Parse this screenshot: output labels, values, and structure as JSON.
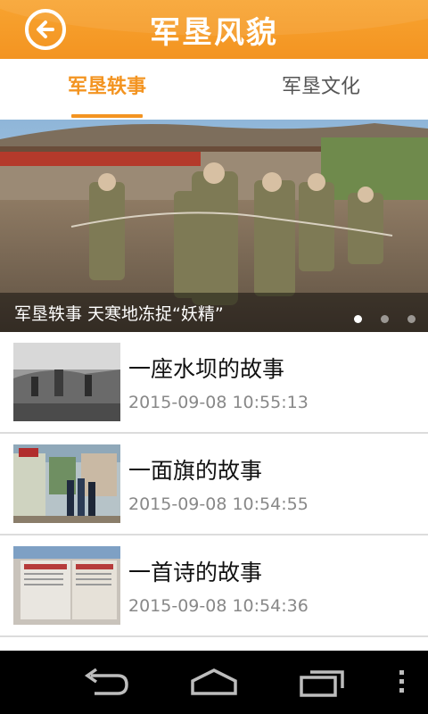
{
  "header": {
    "title": "军垦风貌",
    "back_icon": "back-arrow-icon",
    "accent": "#f39421"
  },
  "tabs": [
    {
      "label": "军垦轶事",
      "active": true
    },
    {
      "label": "军垦文化",
      "active": false
    }
  ],
  "banner": {
    "caption": "军垦轶事 天寒地冻捉“妖精”",
    "page_count": 3,
    "active_page": 1
  },
  "articles": [
    {
      "title": "一座水坝的故事",
      "time": "2015-09-08 10:55:13"
    },
    {
      "title": "一面旗的故事",
      "time": "2015-09-08 10:54:55"
    },
    {
      "title": "一首诗的故事",
      "time": "2015-09-08 10:54:36"
    }
  ],
  "navbar": {
    "icons": [
      "back-icon",
      "home-icon",
      "recent-apps-icon",
      "menu-overflow-icon"
    ]
  }
}
